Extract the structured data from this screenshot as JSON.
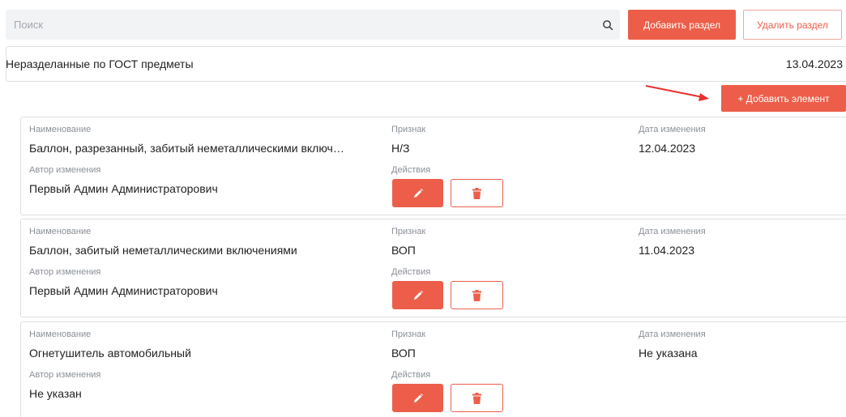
{
  "search": {
    "placeholder": "Поиск",
    "value": ""
  },
  "toolbar": {
    "add_section_label": "Добавить раздел",
    "delete_section_label": "Удалить раздел"
  },
  "section": {
    "title": "Неразделанные по ГОСТ предметы",
    "date": "13.04.2023"
  },
  "add_element_label": "+ Добавить элемент",
  "labels": {
    "name": "Наименование",
    "sign": "Признак",
    "date": "Дата изменения",
    "author": "Автор изменения",
    "actions": "Действия"
  },
  "items": [
    {
      "name": "Баллон, разрезанный, забитый неметаллическими включ…",
      "sign": "Н/З",
      "date": "12.04.2023",
      "author": "Первый Админ Администраторович"
    },
    {
      "name": "Баллон, забитый неметаллическими включениями",
      "sign": "ВОП",
      "date": "11.04.2023",
      "author": "Первый Админ Администраторович"
    },
    {
      "name": "Огнетушитель автомобильный",
      "sign": "ВОП",
      "date": "Не указана",
      "author": "Не указан"
    }
  ],
  "colors": {
    "accent": "#ec5e49",
    "border": "#dcdfe3",
    "muted": "#8a8f96"
  }
}
